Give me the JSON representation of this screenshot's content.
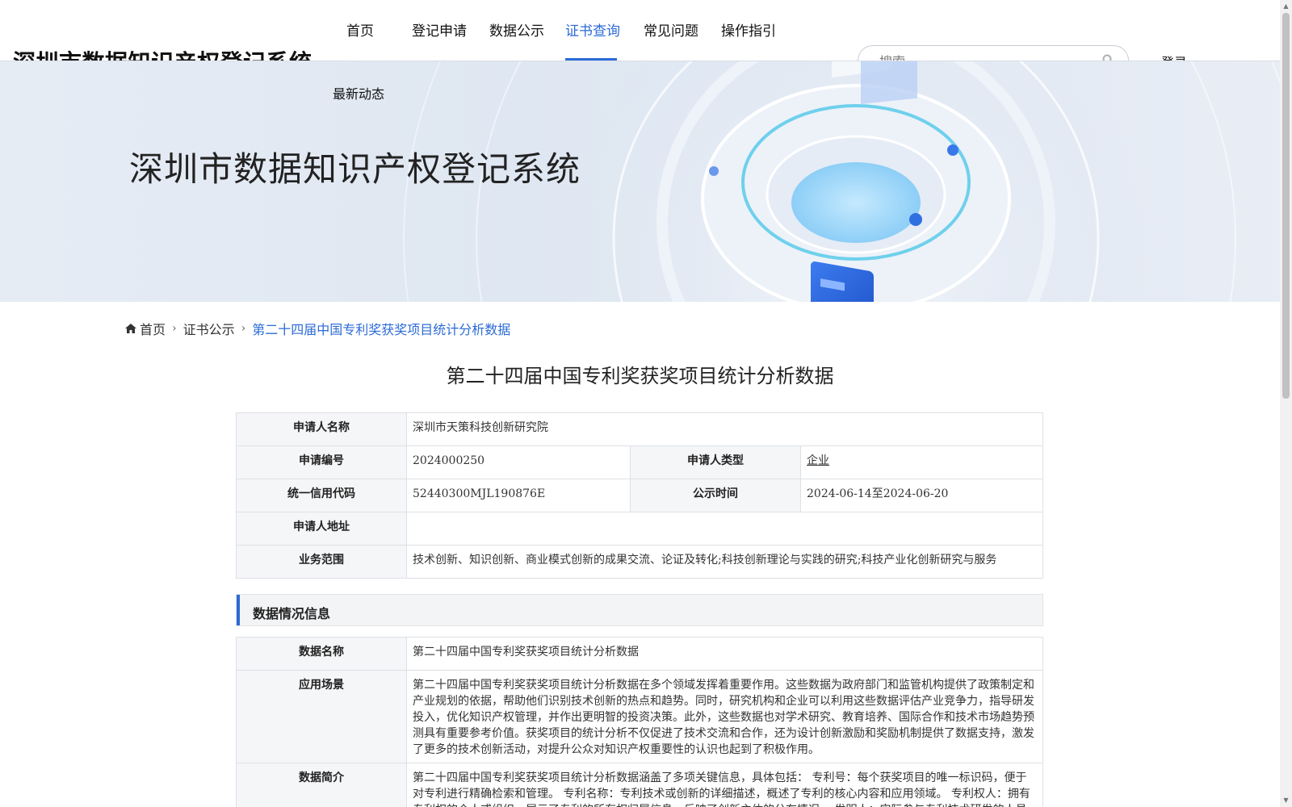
{
  "header": {
    "site_title": "深圳市数据知识产权登记系统",
    "nav": [
      "首页",
      "登记申请",
      "数据公示",
      "证书查询",
      "常见问题",
      "操作指引"
    ],
    "nav_active": "证书查询",
    "nav_second_row": "最新动态",
    "search_placeholder": "搜索",
    "login_label": "登录"
  },
  "banner": {
    "title": "深圳市数据知识产权登记系统"
  },
  "breadcrumb": {
    "home": "首页",
    "section": "证书公示",
    "current": "第二十四届中国专利奖获奖项目统计分析数据"
  },
  "main": {
    "title": "第二十四届中国专利奖获奖项目统计分析数据",
    "applicant": {
      "name_label": "申请人名称",
      "name_value": "深圳市天策科技创新研究院",
      "number_label": "申请编号",
      "number_value": "2024000250",
      "type_label": "申请人类型",
      "type_value": "企业",
      "credit_label": "统一信用代码",
      "credit_value": "52440300MJL190876E",
      "publicity_label": "公示时间",
      "publicity_value": "2024-06-14至2024-06-20",
      "address_label": "申请人地址",
      "address_value": "",
      "scope_label": "业务范围",
      "scope_value": "技术创新、知识创新、商业模式创新的成果交流、论证及转化;科技创新理论与实践的研究;科技产业化创新研究与服务"
    },
    "data_section_title": "数据情况信息",
    "data_info": {
      "data_name_label": "数据名称",
      "data_name_value": "第二十四届中国专利奖获奖项目统计分析数据",
      "scenario_label": "应用场景",
      "scenario_value": "第二十四届中国专利奖获奖项目统计分析数据在多个领域发挥着重要作用。这些数据为政府部门和监管机构提供了政策制定和产业规划的依据，帮助他们识别技术创新的热点和趋势。同时，研究机构和企业可以利用这些数据评估产业竞争力，指导研发投入，优化知识产权管理，并作出更明智的投资决策。此外，这些数据也对学术研究、教育培养、国际合作和技术市场趋势预测具有重要参考价值。获奖项目的统计分析不仅促进了技术交流和合作，还为设计创新激励和奖励机制提供了数据支持，激发了更多的技术创新活动，对提升公众对知识产权重要性的认识也起到了积极作用。",
      "summary_label": "数据简介",
      "summary_value": "第二十四届中国专利奖获奖项目统计分析数据涵盖了多项关键信息，具体包括： 专利号：每个获奖项目的唯一标识码，便于对专利进行精确检索和管理。 专利名称：专利技术或创新的详细描述，概述了专利的核心内容和应用领域。 专利权人：拥有专利权的个人或组织，展示了专利的所有权归属信息，反映了创新主体的分布情况。 发明人：实际参与专利技术研发的人员"
    }
  },
  "colors": {
    "accent": "#2b6bd6",
    "label_bg": "#f5f6f8",
    "border": "#dde1e6"
  }
}
